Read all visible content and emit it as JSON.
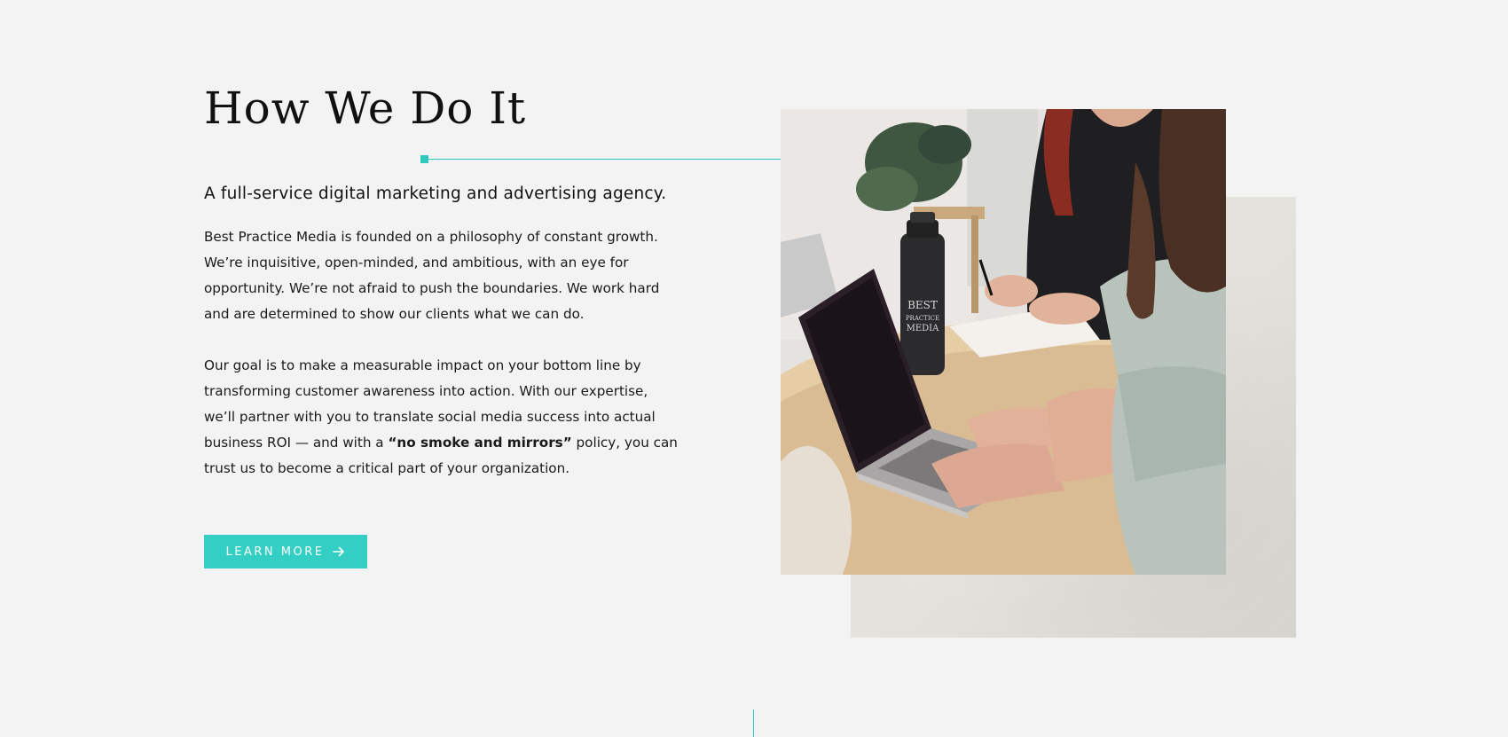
{
  "section": {
    "title": "How We Do It",
    "subtitle": "A full-service digital marketing and advertising agency.",
    "paragraph_1": "Best Practice Media is founded on a philosophy of constant growth. We’re inquisitive, open-minded, and ambitious, with an eye for opportunity. We’re not afraid to push the boundaries. We work hard and are determined to show our clients what we can do.",
    "paragraph_2_before": "Our goal is to make a measurable impact on your bottom line by transforming customer awareness into action. With our expertise, we’ll partner with you to translate social media success into actual business ROI — and with a ",
    "paragraph_2_bold": "“no smoke and mirrors”",
    "paragraph_2_after": " policy, you can trust us to become a critical part of your organization."
  },
  "cta": {
    "label": "LEARN MORE",
    "icon": "arrow-right-icon"
  },
  "photo": {
    "bottle_text": [
      "BEST",
      "PRACTICE",
      "MEDIA"
    ]
  },
  "colors": {
    "accent": "#33cec4",
    "background": "#f3f3f3",
    "text": "#111111"
  }
}
